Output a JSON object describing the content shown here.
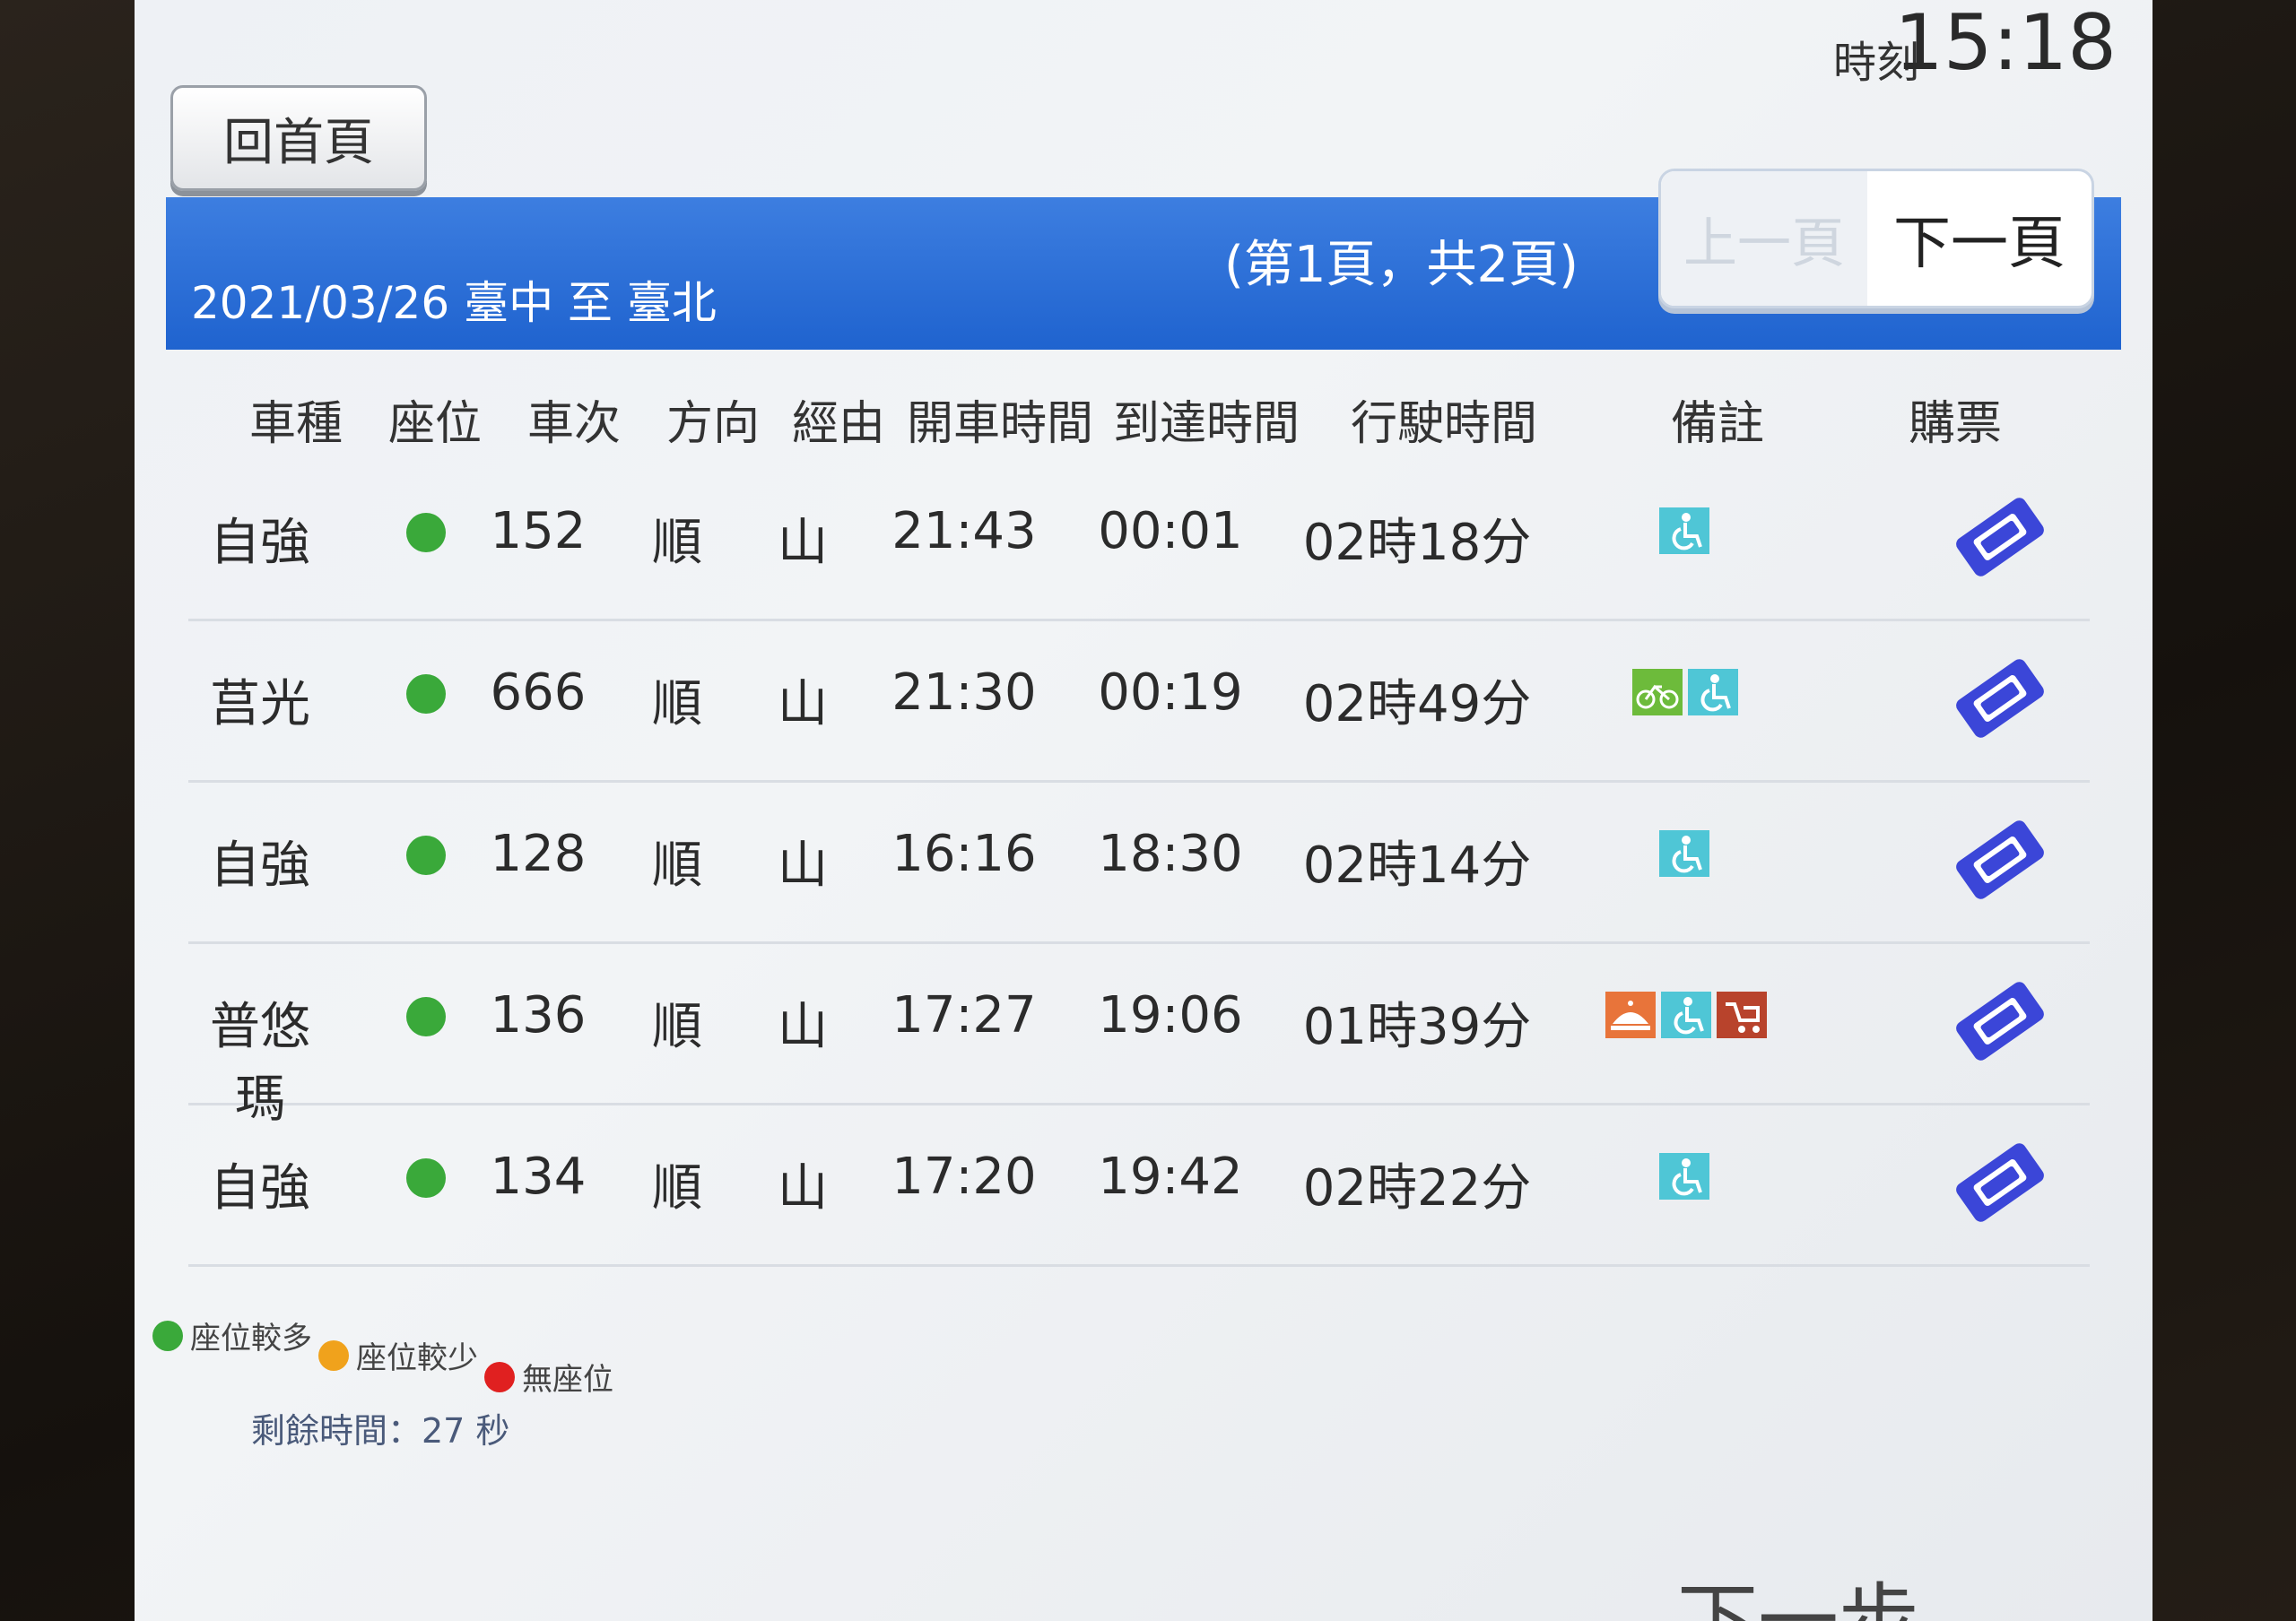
{
  "clock": {
    "label": "時刻",
    "time": "15:18"
  },
  "nav": {
    "home": "回首頁",
    "prev_page": "上一頁",
    "next_page": "下一頁",
    "next_step": "下一步"
  },
  "route_bar": {
    "title": "2021/03/26 臺中 至 臺北",
    "page_info": "(第1頁，共2頁)"
  },
  "headers": [
    "車種",
    "座位",
    "車次",
    "方向",
    "經由",
    "開車時間",
    "到達時間",
    "行駛時間",
    "備註",
    "購票"
  ],
  "rows": [
    {
      "type": "自強",
      "seat": "green",
      "train": "152",
      "direction": "順",
      "via": "山",
      "depart": "21:43",
      "arrive": "00:01",
      "duration": "02時18分",
      "notes": [
        "wheelchair-icon"
      ]
    },
    {
      "type": "莒光",
      "seat": "green",
      "train": "666",
      "direction": "順",
      "via": "山",
      "depart": "21:30",
      "arrive": "00:19",
      "duration": "02時49分",
      "notes": [
        "bicycle-icon",
        "wheelchair-icon"
      ]
    },
    {
      "type": "自強",
      "seat": "green",
      "train": "128",
      "direction": "順",
      "via": "山",
      "depart": "16:16",
      "arrive": "18:30",
      "duration": "02時14分",
      "notes": [
        "wheelchair-icon"
      ]
    },
    {
      "type": "普悠瑪",
      "seat": "green",
      "train": "136",
      "direction": "順",
      "via": "山",
      "depart": "17:27",
      "arrive": "19:06",
      "duration": "01時39分",
      "notes": [
        "meal-icon",
        "wheelchair-icon",
        "stroller-icon"
      ]
    },
    {
      "type": "自強",
      "seat": "green",
      "train": "134",
      "direction": "順",
      "via": "山",
      "depart": "17:20",
      "arrive": "19:42",
      "duration": "02時22分",
      "notes": [
        "wheelchair-icon"
      ]
    }
  ],
  "legend": [
    {
      "label": "座位較多",
      "color": "#3aa93a"
    },
    {
      "label": "座位較少",
      "color": "#f0a21c"
    },
    {
      "label": "無座位",
      "color": "#e02020"
    }
  ],
  "remaining_time": "剩餘時間：27 秒",
  "colors": {
    "bar": "#1f63cf",
    "ticket": "#3b46d8",
    "wheelchair": "#4fc6d6",
    "bicycle": "#6dbb3b",
    "meal": "#e8743a",
    "stroller": "#b8432c"
  }
}
